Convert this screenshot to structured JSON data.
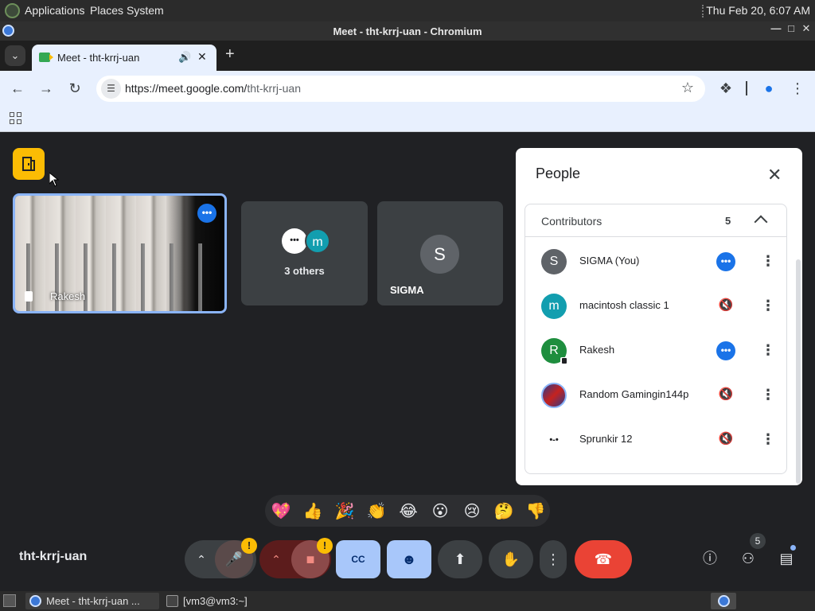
{
  "panel": {
    "menus": [
      "Applications",
      "Places",
      "System"
    ],
    "clock": "Thu Feb 20,  6:07 AM"
  },
  "window": {
    "title": "Meet - tht-krrj-uan - Chromium"
  },
  "tab": {
    "title": "Meet - tht-krrj-uan"
  },
  "toolbar": {
    "url_host": "https://meet.google.com/",
    "url_path": "tht-krrj-uan"
  },
  "meet": {
    "meeting_code": "tht-krrj-uan",
    "tiles": {
      "rakesh": {
        "name": "Rakesh"
      },
      "others": {
        "avatar_a": "•••",
        "avatar_b": "m",
        "label": "3 others"
      },
      "sigma": {
        "initial": "S",
        "name": "SIGMA"
      }
    },
    "reactions": [
      "💖",
      "👍",
      "🎉",
      "👏",
      "😂",
      "😮",
      "😢",
      "🤔",
      "👎"
    ],
    "people_badge": "5",
    "warn_mark": "!"
  },
  "people": {
    "title": "People",
    "section": "Contributors",
    "count": "5",
    "members": [
      {
        "name": "SIGMA (You)",
        "initial": "S",
        "avatar_color": "#5f6368",
        "status": "active"
      },
      {
        "name": "macintosh classic 1",
        "initial": "m",
        "avatar_color": "#129eaf",
        "status": "muted"
      },
      {
        "name": "Rakesh",
        "initial": "R",
        "avatar_color": "#1e8e3e",
        "status": "active"
      },
      {
        "name": "Random Gamingin144p",
        "initial": "",
        "avatar_color": "#3c4f9e",
        "status": "muted"
      },
      {
        "name": "Sprunkir 12",
        "initial": "•-•",
        "avatar_color": "#ffffff",
        "status": "muted"
      }
    ]
  },
  "taskbar": {
    "tasks": [
      "Meet - tht-krrj-uan ...",
      "[vm3@vm3:~]"
    ]
  }
}
